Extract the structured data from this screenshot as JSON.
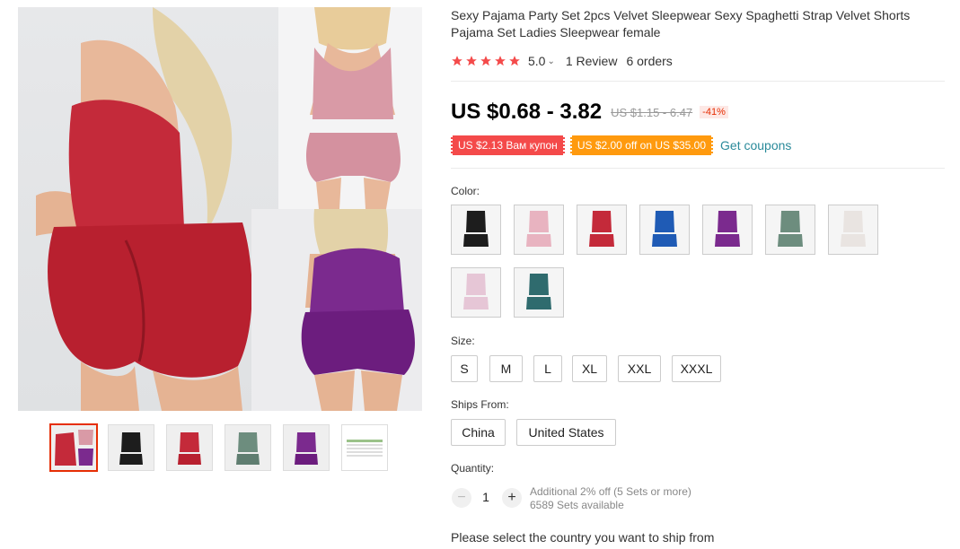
{
  "product": {
    "title": "Sexy Pajama Party Set 2pcs Velvet Sleepwear Sexy Spaghetti Strap Velvet Shorts Pajama Set Ladies Sleepwear female"
  },
  "rating": {
    "score": "5.0",
    "reviews": "1 Review",
    "orders": "6 orders",
    "star_color": "#f44a4a"
  },
  "price": {
    "current": "US $0.68 - 3.82",
    "original": "US $1.15 - 6.47",
    "discount": "-41%"
  },
  "coupons": {
    "items": [
      {
        "label": "US $2.13 Вам купон",
        "color": "#f44a4a"
      },
      {
        "label": "US $2.00 off on US $35.00",
        "color": "#ff9a0e"
      }
    ],
    "get_label": "Get coupons"
  },
  "color_section": {
    "label": "Color:",
    "swatches": [
      {
        "name": "black",
        "color": "#1d1d1d"
      },
      {
        "name": "pink",
        "color": "#e8b3c0"
      },
      {
        "name": "red",
        "color": "#c42a3a"
      },
      {
        "name": "blue",
        "color": "#1f5bb5"
      },
      {
        "name": "purple",
        "color": "#7b2a8e"
      },
      {
        "name": "green",
        "color": "#6d8d7e"
      },
      {
        "name": "white",
        "color": "#e9e4e1"
      },
      {
        "name": "light-pink",
        "color": "#e6c6d6"
      },
      {
        "name": "teal",
        "color": "#2f6b6e"
      }
    ]
  },
  "size_section": {
    "label": "Size:",
    "options": [
      "S",
      "M",
      "L",
      "XL",
      "XXL",
      "XXXL"
    ]
  },
  "ships_section": {
    "label": "Ships From:",
    "options": [
      "China",
      "United States"
    ]
  },
  "quantity_section": {
    "label": "Quantity:",
    "minus": "−",
    "value": "1",
    "plus": "+",
    "note_line1": "Additional 2% off (5 Sets or more)",
    "note_line2": "6589 Sets available"
  },
  "ship_message": "Please select the country you want to ship from",
  "gallery": {
    "thumb_colors": [
      "#c42a3a",
      "#1d1d1d",
      "#c42a3a",
      "#6d8d7e",
      "#7b2a8e",
      "#e8f0e0"
    ]
  }
}
